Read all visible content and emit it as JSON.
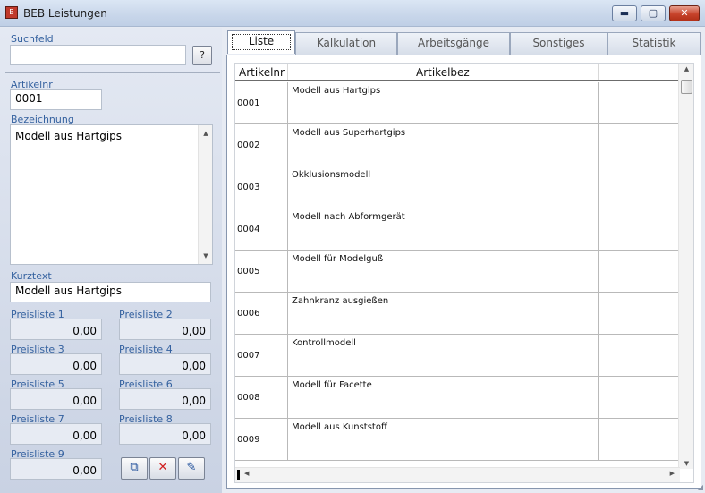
{
  "window": {
    "title": "BEB Leistungen",
    "icon_glyph": "B",
    "minimize_glyph": "▬",
    "maximize_glyph": "▢",
    "close_glyph": "✕"
  },
  "left": {
    "search_label": "Suchfeld",
    "search_value": "",
    "help_button": "?",
    "artikelnr_label": "Artikelnr",
    "artikelnr_value": "0001",
    "bezeichnung_label": "Bezeichnung",
    "bezeichnung_value": "Modell aus Hartgips",
    "kurztext_label": "Kurztext",
    "kurztext_value": "Modell aus Hartgips",
    "prices": [
      {
        "label": "Preisliste 1",
        "value": "0,00"
      },
      {
        "label": "Preisliste 2",
        "value": "0,00"
      },
      {
        "label": "Preisliste 3",
        "value": "0,00"
      },
      {
        "label": "Preisliste 4",
        "value": "0,00"
      },
      {
        "label": "Preisliste 5",
        "value": "0,00"
      },
      {
        "label": "Preisliste 6",
        "value": "0,00"
      },
      {
        "label": "Preisliste 7",
        "value": "0,00"
      },
      {
        "label": "Preisliste 8",
        "value": "0,00"
      },
      {
        "label": "Preisliste 9",
        "value": "0,00"
      }
    ],
    "actions": {
      "copy_glyph": "⧉",
      "delete_glyph": "✕",
      "edit_glyph": "✎"
    }
  },
  "tabs": [
    "Liste",
    "Kalkulation",
    "Arbeitsgänge",
    "Sonstiges",
    "Statistik"
  ],
  "grid": {
    "headers": [
      "Artikelnr",
      "Artikelbez"
    ],
    "rows": [
      {
        "nr": "0001",
        "bez": "Modell aus Hartgips"
      },
      {
        "nr": "0002",
        "bez": "Modell aus Superhartgips"
      },
      {
        "nr": "0003",
        "bez": "Okklusionsmodell"
      },
      {
        "nr": "0004",
        "bez": "Modell nach Abformgerät"
      },
      {
        "nr": "0005",
        "bez": "Modell für Modelguß"
      },
      {
        "nr": "0006",
        "bez": "Zahnkranz ausgießen"
      },
      {
        "nr": "0007",
        "bez": "Kontrollmodell"
      },
      {
        "nr": "0008",
        "bez": "Modell für Facette"
      },
      {
        "nr": "0009",
        "bez": "Modell aus Kunststoff"
      }
    ]
  },
  "colors": {
    "label_blue": "#34619f",
    "close_red": "#c7432b",
    "delete_red": "#d11f1f"
  }
}
